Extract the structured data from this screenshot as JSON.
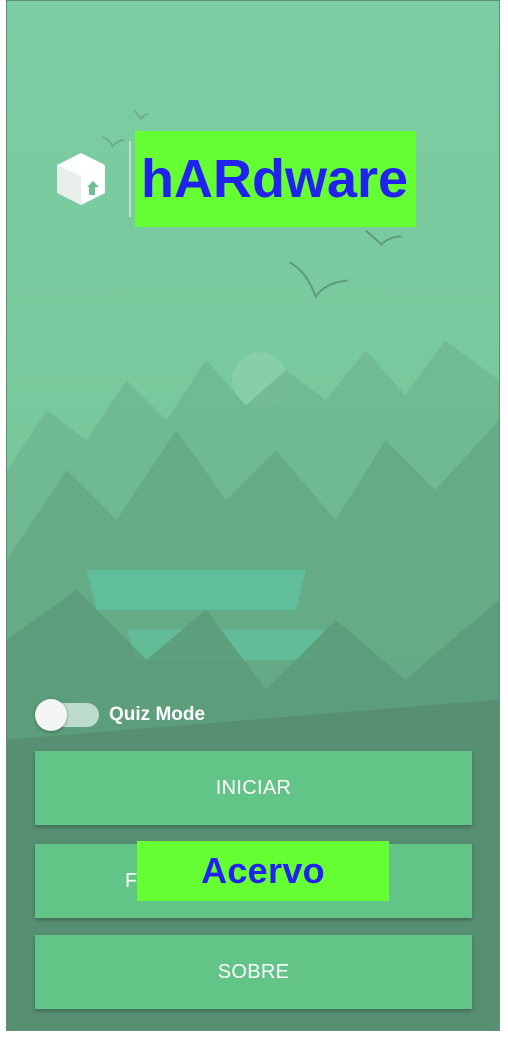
{
  "app": {
    "title": "hARdware",
    "logo_icon": "cube-icon"
  },
  "quiz": {
    "label": "Quiz Mode",
    "enabled": false
  },
  "buttons": {
    "iniciar": "INICIAR",
    "acervo_prefix": "F",
    "acervo": "Acervo",
    "sobre": "SOBRE"
  },
  "colors": {
    "background": "#6fbf94",
    "button": "#63c487",
    "highlight": "#66ff33",
    "title_text": "#2222ee"
  }
}
